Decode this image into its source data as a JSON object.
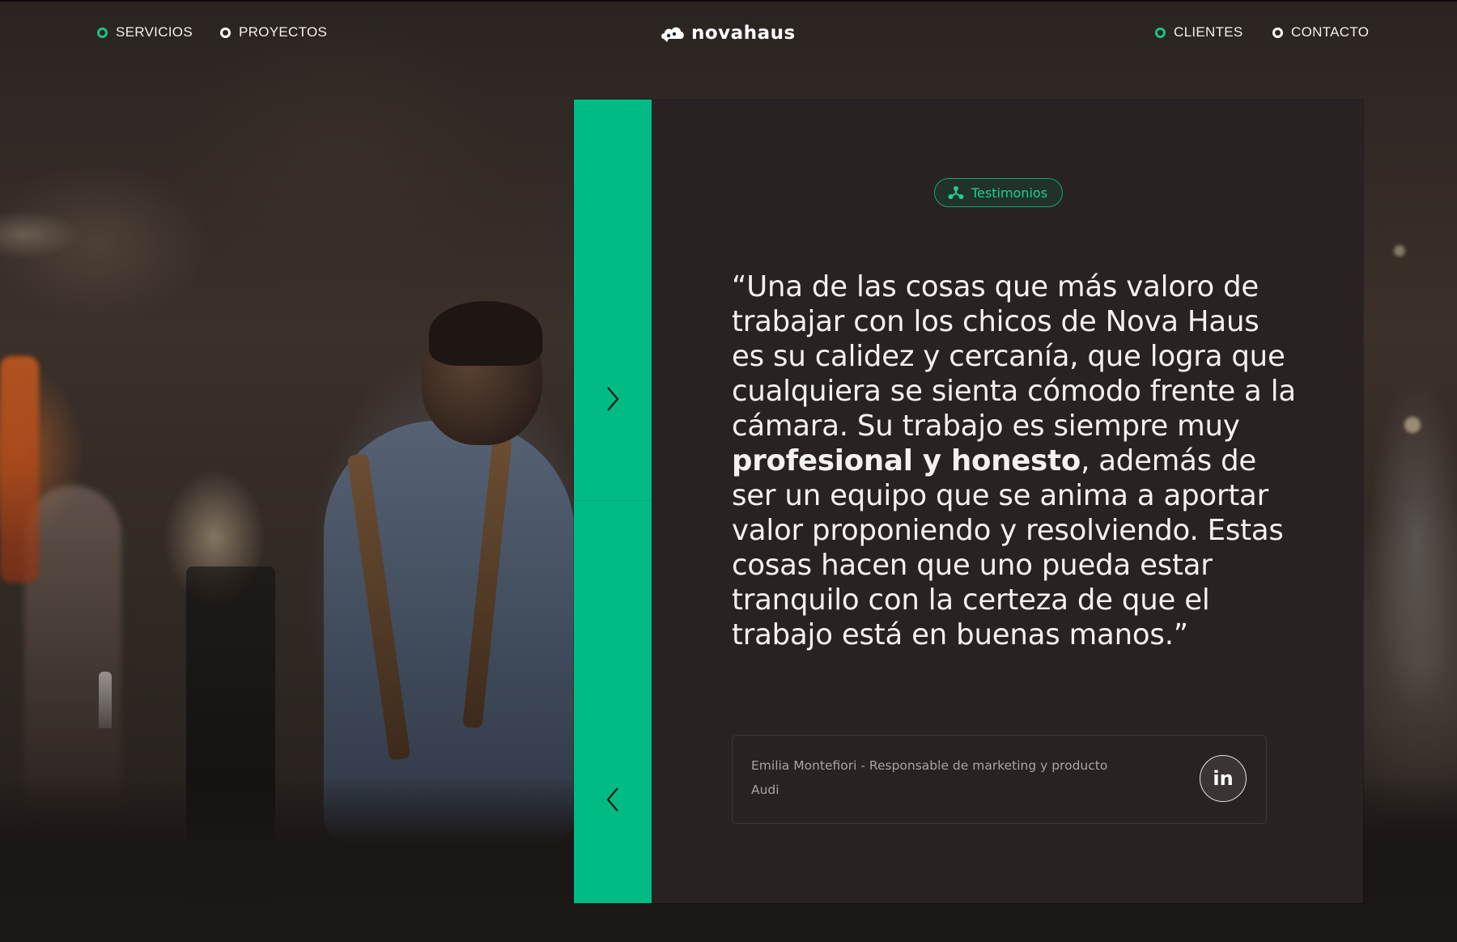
{
  "nav": {
    "left": [
      {
        "label": "SERVICIOS",
        "accent": true
      },
      {
        "label": "PROYECTOS",
        "accent": false
      }
    ],
    "right": [
      {
        "label": "CLIENTES",
        "accent": true
      },
      {
        "label": "CONTACTO",
        "accent": false
      }
    ],
    "logo_text": "novahaus"
  },
  "testimonial": {
    "tag_label": "Testimonios",
    "quote_before": "“Una de las cosas que más valoro de trabajar con los chicos de Nova Haus es su calidez y cercanía, que logra que cualquiera se sienta cómodo frente a la cámara. Su trabajo es siempre muy ",
    "quote_bold": "profesional y honesto",
    "quote_after": ", además de ser un equipo que se anima a aportar valor proponiendo y resolviendo. Estas cosas hacen que uno pueda estar tranquilo con la certeza de que el trabajo está en buenas manos.”",
    "author": "Emilia Montefiori - Responsable de marketing y producto",
    "company": "Audi",
    "social_label": "in"
  },
  "icons": {
    "next": "chevron-right-icon",
    "prev": "chevron-left-icon",
    "tag": "nodes-icon",
    "logo": "cloud-logo-icon"
  },
  "colors": {
    "accent": "#00bb83",
    "card": "#282322",
    "text": "#f4f1ee"
  }
}
